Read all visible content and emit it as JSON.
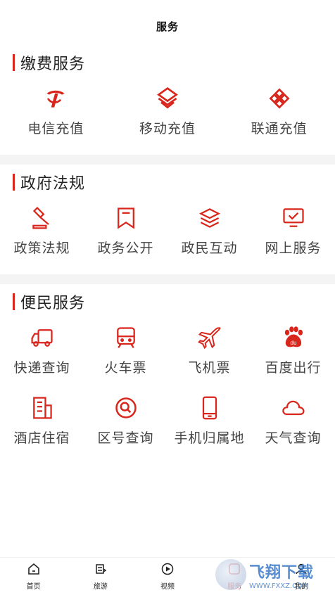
{
  "header": {
    "title": "服务"
  },
  "sections": [
    {
      "title": "缴费服务",
      "items": [
        {
          "label": "电信充值",
          "icon": "telecom-icon"
        },
        {
          "label": "移动充值",
          "icon": "mobile-icon"
        },
        {
          "label": "联通充值",
          "icon": "unicom-icon"
        }
      ]
    },
    {
      "title": "政府法规",
      "items": [
        {
          "label": "政策法规",
          "icon": "gavel-icon"
        },
        {
          "label": "政务公开",
          "icon": "bookmark-icon"
        },
        {
          "label": "政民互动",
          "icon": "layers-icon"
        },
        {
          "label": "网上服务",
          "icon": "monitor-icon"
        }
      ]
    },
    {
      "title": "便民服务",
      "items": [
        {
          "label": "快递查询",
          "icon": "truck-icon"
        },
        {
          "label": "火车票",
          "icon": "train-icon"
        },
        {
          "label": "飞机票",
          "icon": "airplane-icon"
        },
        {
          "label": "百度出行",
          "icon": "baidu-icon"
        },
        {
          "label": "酒店住宿",
          "icon": "hotel-icon"
        },
        {
          "label": "区号查询",
          "icon": "search-icon"
        },
        {
          "label": "手机归属地",
          "icon": "phone-icon"
        },
        {
          "label": "天气查询",
          "icon": "cloud-icon"
        }
      ]
    }
  ],
  "tabbar": [
    {
      "label": "首页",
      "icon": "home-icon"
    },
    {
      "label": "旅游",
      "icon": "travel-icon"
    },
    {
      "label": "视频",
      "icon": "play-icon"
    },
    {
      "label": "服务",
      "icon": "service-icon",
      "active": true
    },
    {
      "label": "我的",
      "icon": "user-icon"
    }
  ],
  "watermark": {
    "main": "飞翔下载",
    "sub": "WWW.FXXZ.COM"
  },
  "colors": {
    "accent": "#d9261c",
    "divider": "#f4f4f4"
  }
}
